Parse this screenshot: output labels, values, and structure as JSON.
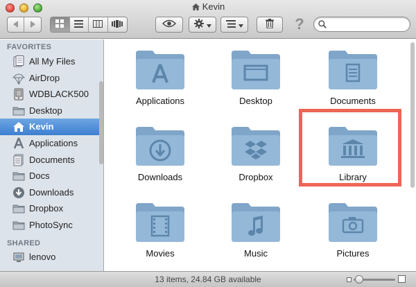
{
  "window": {
    "title": "Kevin"
  },
  "toolbar": {
    "search_placeholder": "",
    "help_label": "?"
  },
  "sidebar": {
    "favorites_header": "FAVORITES",
    "shared_header": "SHARED",
    "favorites": [
      {
        "label": "All My Files",
        "icon": "all-files-icon"
      },
      {
        "label": "AirDrop",
        "icon": "airdrop-icon"
      },
      {
        "label": "WDBLACK500",
        "icon": "drive-icon"
      },
      {
        "label": "Desktop",
        "icon": "folder-icon"
      },
      {
        "label": "Kevin",
        "icon": "home-icon",
        "selected": true
      },
      {
        "label": "Applications",
        "icon": "applications-icon"
      },
      {
        "label": "Documents",
        "icon": "documents-icon"
      },
      {
        "label": "Docs",
        "icon": "folder-icon"
      },
      {
        "label": "Downloads",
        "icon": "downloads-icon"
      },
      {
        "label": "Dropbox",
        "icon": "folder-icon"
      },
      {
        "label": "PhotoSync",
        "icon": "folder-icon"
      }
    ],
    "shared": [
      {
        "label": "lenovo",
        "icon": "computer-icon"
      }
    ]
  },
  "main": {
    "items": [
      {
        "label": "Applications",
        "icon": "applications-folder-icon"
      },
      {
        "label": "Desktop",
        "icon": "desktop-folder-icon"
      },
      {
        "label": "Documents",
        "icon": "documents-folder-icon"
      },
      {
        "label": "Downloads",
        "icon": "downloads-folder-icon"
      },
      {
        "label": "Dropbox",
        "icon": "dropbox-folder-icon"
      },
      {
        "label": "Library",
        "icon": "library-folder-icon",
        "highlighted": true
      },
      {
        "label": "Movies",
        "icon": "movies-folder-icon"
      },
      {
        "label": "Music",
        "icon": "music-folder-icon"
      },
      {
        "label": "Pictures",
        "icon": "pictures-folder-icon"
      }
    ]
  },
  "status": {
    "text": "13 items, 24.84 GB available"
  },
  "colors": {
    "highlight": "#ef6554",
    "selection": "#3d7fd0",
    "folder": "#8fb2d1"
  }
}
